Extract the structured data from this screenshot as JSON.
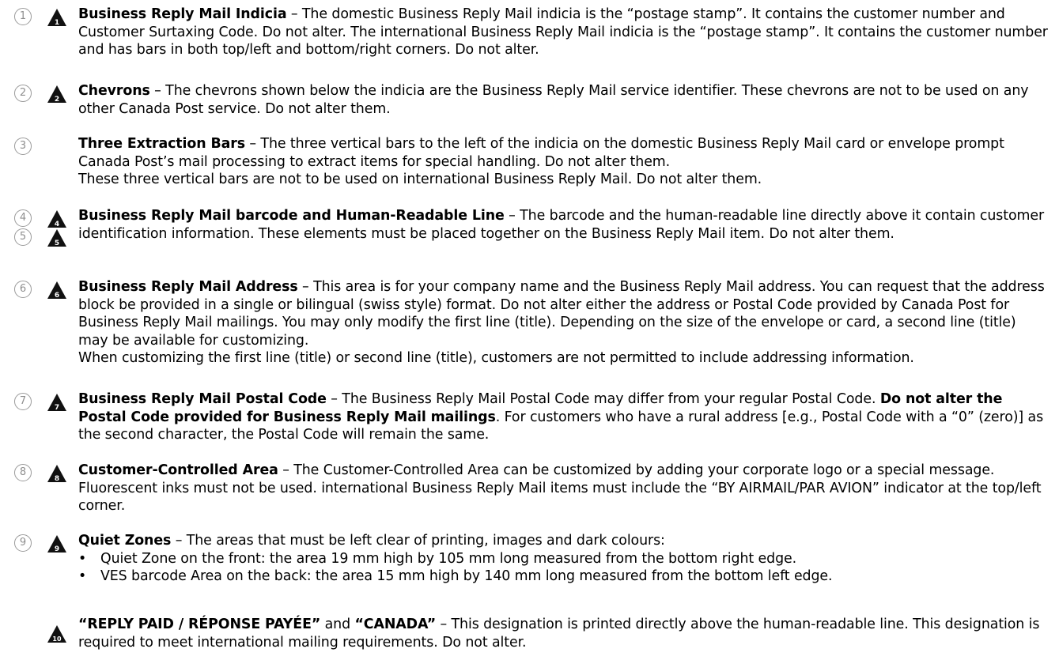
{
  "items": [
    {
      "number": "1",
      "marker": "1",
      "title": "Business Reply Mail Indicia",
      "body": " – The domestic Business Reply Mail indicia is the “postage stamp”. It contains the customer number and Customer Surtaxing Code. Do not alter. The international Business Reply Mail indicia is the “postage stamp”. It contains the customer number and has bars in both top/left and bottom/right corners. Do not alter."
    },
    {
      "number": "2",
      "marker": "2",
      "title": "Chevrons",
      "body": " – The chevrons shown below the indicia are the Business Reply Mail service identifier. These chevrons are not to be used on any other Canada Post service. Do not alter them."
    },
    {
      "number": "3",
      "title": "Three Extraction Bars",
      "body": " – The three vertical bars to the left of the indicia on the domestic Business Reply Mail card or envelope prompt Canada Post’s mail processing to extract items for special handling. Do not alter them.",
      "body2": "These three vertical bars are not to be used on international Business Reply Mail. Do not alter them."
    },
    {
      "number": "4",
      "number_b": "5",
      "marker": "4",
      "marker_b": "5",
      "title": "Business Reply Mail barcode and Human-Readable Line",
      "body": " – The barcode and the human-readable line directly above it contain customer identification information. These elements must be placed together on the Business Reply Mail item. Do not alter them."
    },
    {
      "number": "6",
      "marker": "6",
      "title": "Business Reply Mail Address",
      "body": " – This area is for your company name and the Business Reply Mail address. You can request that the address block be provided in a single or bilingual (swiss style) format. Do not alter either the address or Postal Code provided by Canada Post for Business Reply Mail mailings. You may only modify the first line (title). Depending on the size of the envelope or card, a second line (title) may be available for customizing.",
      "body2": "When customizing the first line (title) or second line (title), customers are not permitted to include addressing information."
    },
    {
      "number": "7",
      "marker": "7",
      "title": "Business Reply Mail Postal Code",
      "body": " – The Business Reply Mail Postal Code may differ from your regular Postal Code. ",
      "bold_mid": "Do not alter the Postal Code provided for Business Reply Mail mailings",
      "body_after": ". For customers who have a rural address [e.g., Postal Code with a “0” (zero)] as the second character, the Postal Code will remain the same."
    },
    {
      "number": "8",
      "marker": "8",
      "title": "Customer-Controlled Area",
      "body": " – The Customer-Controlled Area can be customized by adding your corporate logo or a special message. Fluorescent inks must not be used. international Business Reply Mail items must include the “BY AIRMAIL/PAR AVION” indicator at the top/left corner."
    },
    {
      "number": "9",
      "marker": "9",
      "title": "Quiet Zones",
      "body": " – The areas that must be left clear of printing, images and dark colours:",
      "bullets": [
        "Quiet Zone on the front: the area 19 mm high by 105 mm long measured from the bottom right edge.",
        "VES barcode Area on the back: the area 15 mm high by 140 mm long measured from the bottom left edge."
      ]
    },
    {
      "marker": "10",
      "title": "“REPLY PAID / RÉPONSE PAYÉE”",
      "joiner": " and ",
      "title2": "“CANADA”",
      "body": " – This designation is printed directly above the human-readable line. This designation is required to meet international mailing requirements. Do not alter."
    }
  ],
  "colors": {
    "marker": "#111111",
    "circled_number": "#8e8e8e"
  },
  "icons": {
    "marker": "warning-triangle-icon",
    "number": "circled-number-icon"
  }
}
